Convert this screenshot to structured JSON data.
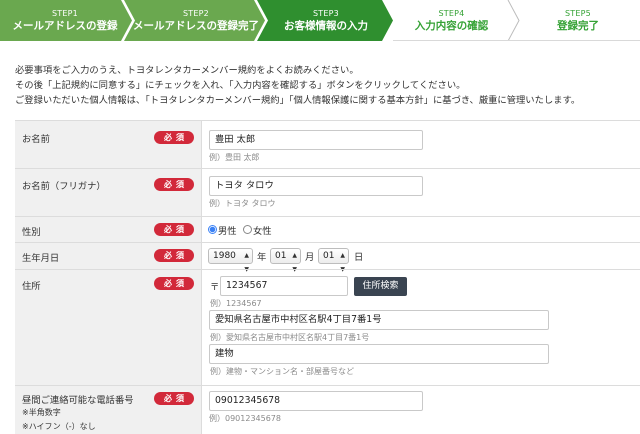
{
  "steps": [
    {
      "num": "STEP1",
      "label": "メールアドレスの登録",
      "state": "done"
    },
    {
      "num": "STEP2",
      "label": "メールアドレスの登録完了",
      "state": "done"
    },
    {
      "num": "STEP3",
      "label": "お客様情報の入力",
      "state": "current"
    },
    {
      "num": "STEP4",
      "label": "入力内容の確認",
      "state": "todo"
    },
    {
      "num": "STEP5",
      "label": "登録完了",
      "state": "todo"
    }
  ],
  "colors": {
    "done": "#6aa84f",
    "current": "#2f8f2f",
    "todo_text": "#35a235",
    "required": "#d2293a",
    "button": "#3a4451"
  },
  "intro": [
    "必要事項をご入力のうえ、トヨタレンタカーメンバー規約をよくお読みください。",
    "その後「上記規約に同意する」にチェックを入れ、「入力内容を確認する」ボタンをクリックしてください。",
    "ご登録いただいた個人情報は、「トヨタレンタカーメンバー規約」「個人情報保護に関する基本方針」に基づき、厳重に管理いたします。"
  ],
  "required_label": "必須",
  "form": {
    "name": {
      "label": "お名前",
      "value": "豊田 太郎",
      "example": "例）豊田 太郎"
    },
    "kana": {
      "label": "お名前（フリガナ）",
      "value": "トヨタ タロウ",
      "example": "例）トヨタ タロウ"
    },
    "gender": {
      "label": "性別",
      "options": [
        "男性",
        "女性"
      ],
      "selected": "男性"
    },
    "birthday": {
      "label": "生年月日",
      "year": "1980",
      "month": "01",
      "day": "01",
      "year_unit": "年",
      "month_unit": "月",
      "day_unit": "日"
    },
    "address": {
      "label": "住所",
      "postal_mark": "〒",
      "postal_value": "1234567",
      "postal_example": "例）1234567",
      "search_button": "住所検索",
      "line1_value": "愛知県名古屋市中村区名駅4丁目7番1号",
      "line1_example": "例）愛知県名古屋市中村区名駅4丁目7番1号",
      "line2_value": "建物",
      "line2_example": "例）建物・マンション名・部屋番号など"
    },
    "phone": {
      "label": "昼間ご連絡可能な電話番号",
      "note1": "※半角数字",
      "note2": "※ハイフン（-）なし",
      "value": "09012345678",
      "example": "例）09012345678"
    }
  }
}
